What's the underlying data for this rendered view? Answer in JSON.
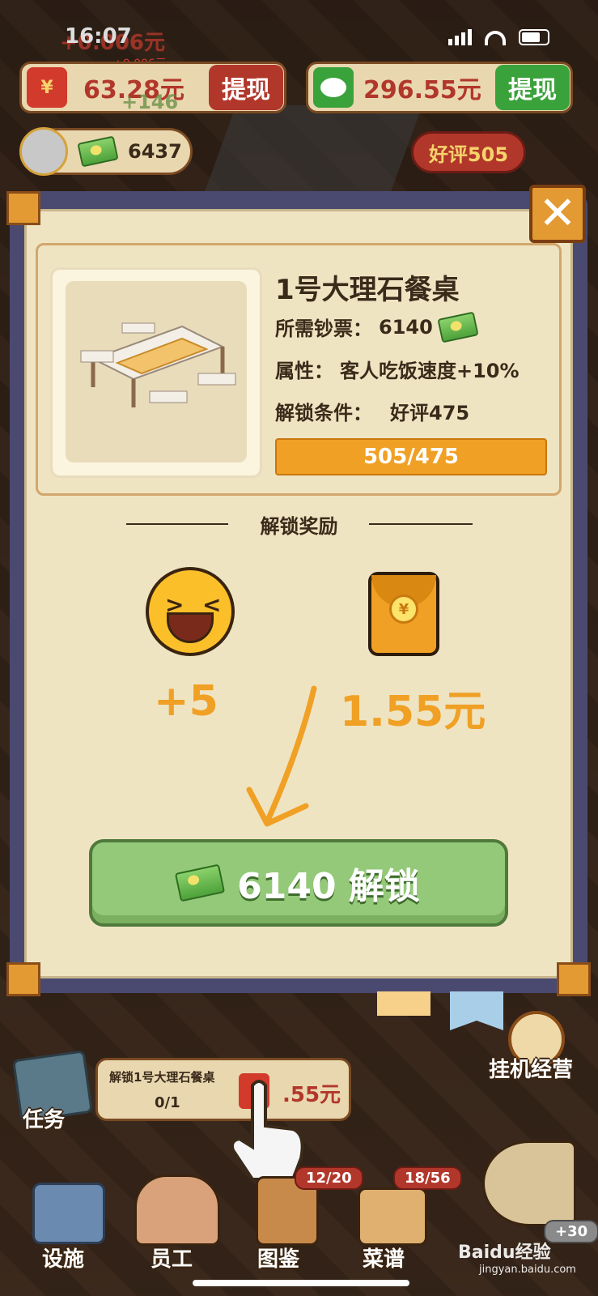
{
  "status_bar": {
    "time": "16:07",
    "floating_reward": "+0.006元"
  },
  "balances": {
    "redpack": {
      "note": "+0.006元",
      "amount": "63.28元",
      "withdraw_label": "提现",
      "cash_bonus": "+146"
    },
    "wechat": {
      "amount": "296.55元",
      "withdraw_label": "提现"
    },
    "cash": {
      "amount": "6437"
    },
    "good_reviews": "好评505"
  },
  "modal": {
    "item_title": "1号大理石餐桌",
    "cost_label": "所需钞票：",
    "cost_value": "6140",
    "attr_label": "属性：",
    "attr_value": "客人吃饭速度+10%",
    "unlock_cond_label": "解锁条件：",
    "unlock_cond_value": "好评475",
    "progress_text": "505/475",
    "progress_fraction": 1.0,
    "reward_section_title": "解锁奖励",
    "rewards": [
      {
        "icon": "laugh-emoji-icon",
        "value": "+5"
      },
      {
        "icon": "red-envelope-icon",
        "value": "1.55元"
      }
    ],
    "unlock_button_label": "6140 解锁"
  },
  "task": {
    "text": "解锁1号大理石餐桌",
    "progress": "0/1",
    "reward": ".55元",
    "label": "任务"
  },
  "idle_label": "挂机经营",
  "bottom_nav": [
    {
      "label": "设施"
    },
    {
      "label": "员工"
    },
    {
      "label": "图鉴",
      "badge": "12/20"
    },
    {
      "label": "菜谱",
      "badge": "18/56"
    }
  ],
  "plus_badge": "+30",
  "watermark": {
    "brand": "Baidu经验",
    "url": "jingyan.baidu.com"
  },
  "colors": {
    "orange": "#f0a024",
    "green": "#93c978",
    "red": "#b2372b",
    "modal_frame": "#4a4a70",
    "parchment": "#efe4c2"
  }
}
